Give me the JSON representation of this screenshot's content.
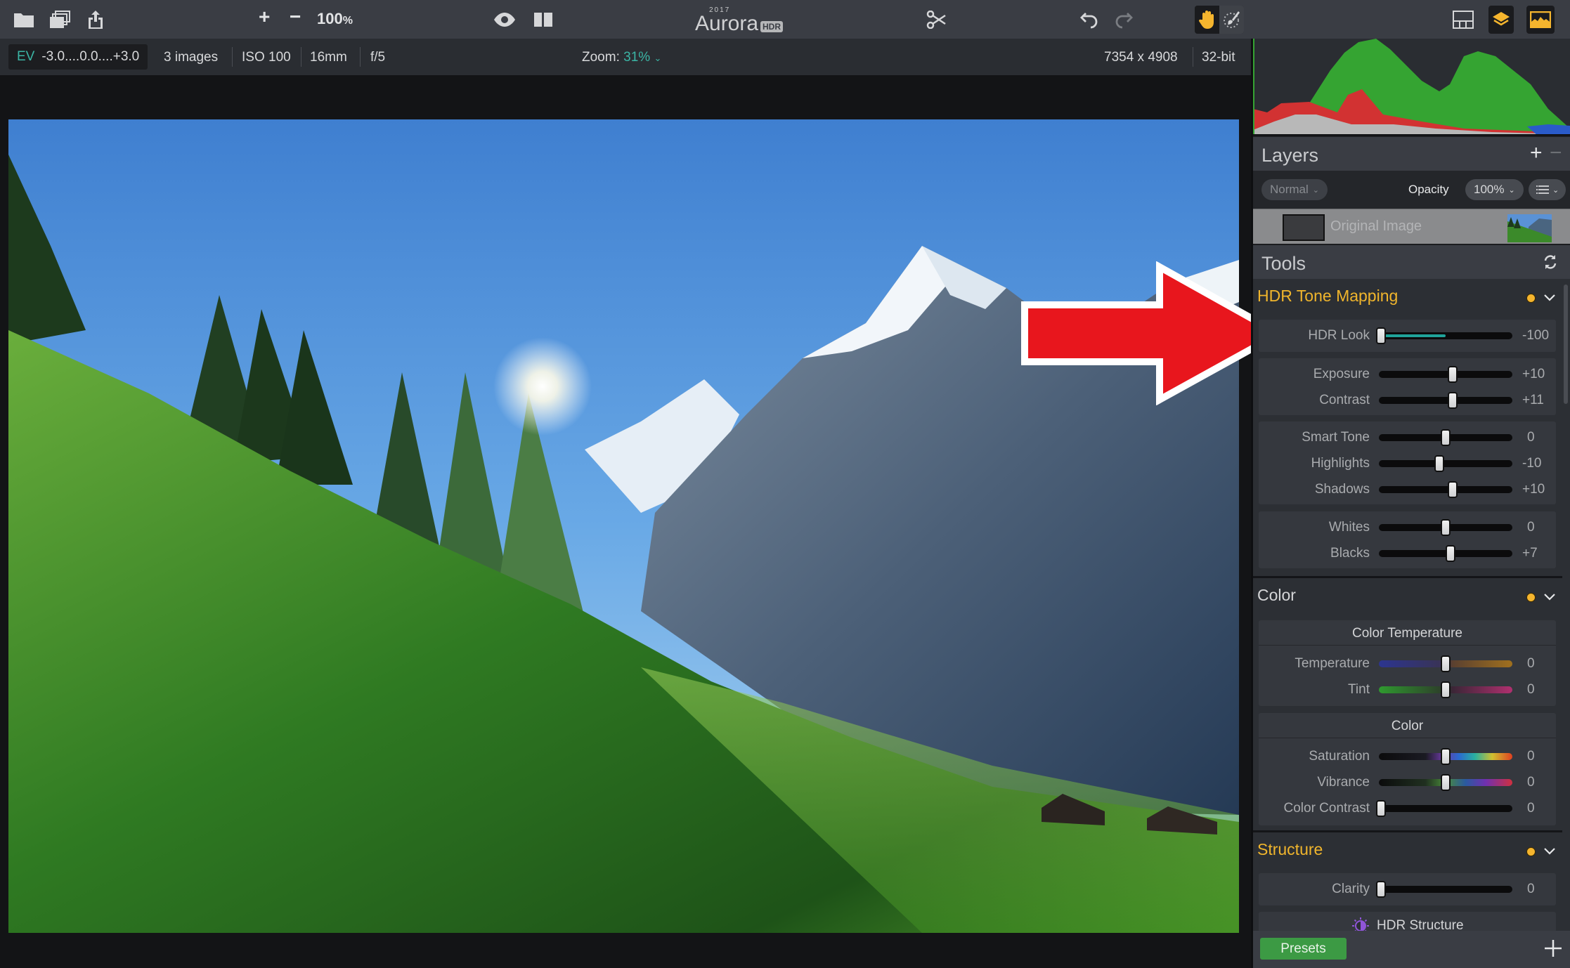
{
  "app": {
    "name": "Aurora",
    "year": "2017",
    "badge": "HDR"
  },
  "toolbar": {
    "zoom_in": "+",
    "zoom_out": "−",
    "zoom_percent": "100",
    "zoom_suffix": "%",
    "icons": {
      "open": "folder-icon",
      "batch": "stack-icon",
      "share": "share-icon",
      "preview": "eye-icon",
      "compare": "split-view-icon",
      "crop": "scissors-icon",
      "undo": "undo-icon",
      "redo": "redo-icon",
      "hand": "hand-icon",
      "brush": "brush-icon",
      "layout": "layout-icon",
      "layers_toggle": "layers-icon",
      "histogram_toggle": "histogram-icon"
    },
    "accent": "#f5b52e"
  },
  "infobar": {
    "ev_label": "EV",
    "ev_range": "-3.0....0.0....+3.0",
    "images": "3 images",
    "iso": "ISO 100",
    "focal": "16mm",
    "aperture": "f/5",
    "zoom_label": "Zoom:",
    "zoom_value": "31%",
    "dimensions": "7354 x 4908",
    "bit_depth": "32-bit",
    "accent": "#3bb5a5"
  },
  "layers": {
    "title": "Layers",
    "add": "+",
    "remove": "−",
    "blend_mode": "Normal",
    "opacity_label": "Opacity",
    "opacity_value": "100%",
    "layer_name": "Original Image"
  },
  "tools": {
    "title": "Tools",
    "sections": [
      {
        "title": "HDR Tone Mapping",
        "color": "#f0b52c",
        "sliders": [
          {
            "label": "HDR Look",
            "value": "-100",
            "position": 0.0,
            "fill_to": 0.48
          },
          {
            "label": "Exposure",
            "value": "+10",
            "position": 0.55
          },
          {
            "label": "Contrast",
            "value": "+11",
            "position": 0.555
          },
          {
            "label": "Smart Tone",
            "value": "0",
            "position": 0.5
          },
          {
            "label": "Highlights",
            "value": "-10",
            "position": 0.45
          },
          {
            "label": "Shadows",
            "value": "+10",
            "position": 0.55
          },
          {
            "label": "Whites",
            "value": "0",
            "position": 0.5
          },
          {
            "label": "Blacks",
            "value": "+7",
            "position": 0.535
          }
        ]
      },
      {
        "title": "Color",
        "color": "#d5d6d8",
        "groups": [
          "Color Temperature",
          "Color"
        ],
        "sliders": [
          {
            "label": "Temperature",
            "value": "0",
            "position": 0.5
          },
          {
            "label": "Tint",
            "value": "0",
            "position": 0.5
          },
          {
            "label": "Saturation",
            "value": "0",
            "position": 0.5
          },
          {
            "label": "Vibrance",
            "value": "0",
            "position": 0.5
          },
          {
            "label": "Color Contrast",
            "value": "0",
            "position": 0.0
          }
        ]
      },
      {
        "title": "Structure",
        "color": "#f0b52c",
        "sliders": [
          {
            "label": "Clarity",
            "value": "0",
            "position": 0.0
          }
        ],
        "subtool": "HDR Structure"
      }
    ]
  },
  "bottombar": {
    "presets": "Presets",
    "add": "+"
  },
  "annotation": {
    "type": "red-arrow",
    "points_to": "HDR Look",
    "color": "#e8161d"
  }
}
